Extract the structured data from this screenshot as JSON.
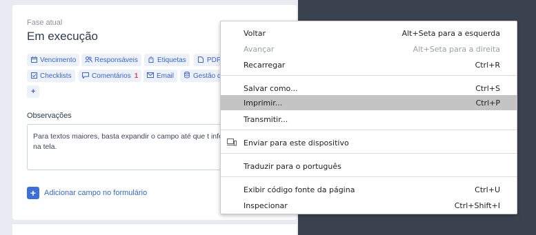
{
  "card": {
    "phase_label": "Fase atual",
    "phase_title": "Em execução",
    "chips": [
      {
        "label": "Vencimento",
        "icon": "calendar-icon"
      },
      {
        "label": "Responsáveis",
        "icon": "users-icon"
      },
      {
        "label": "Etiquetas",
        "icon": "tag-icon"
      },
      {
        "label": "PDF",
        "icon": "document-icon"
      },
      {
        "label": "Checklists",
        "icon": "checklist-icon"
      },
      {
        "label": "Comentários",
        "icon": "comment-icon",
        "count": "1"
      },
      {
        "label": "Email",
        "icon": "mail-icon"
      },
      {
        "label": "Gestão d",
        "icon": "database-icon"
      },
      {
        "label": "+",
        "icon": ""
      }
    ],
    "observations_label": "Observações",
    "observations_text": "Para textos maiores, basta expandir o campo até que t informação esteja visível na tela.",
    "add_field_label": "Adicionar campo no formulário"
  },
  "context_menu": {
    "items": [
      {
        "label": "Voltar",
        "shortcut": "Alt+Seta para a esquerda"
      },
      {
        "label": "Avançar",
        "shortcut": "Alt+Seta para a direita",
        "disabled": true
      },
      {
        "label": "Recarregar",
        "shortcut": "Ctrl+R"
      },
      {
        "label": "Salvar como...",
        "shortcut": "Ctrl+S"
      },
      {
        "label": "Imprimir...",
        "shortcut": "Ctrl+P",
        "highlighted": true
      },
      {
        "label": "Transmitir...",
        "shortcut": ""
      },
      {
        "label": "Enviar para este dispositivo",
        "shortcut": "",
        "icon": "devices-icon"
      },
      {
        "label": "Traduzir para o português",
        "shortcut": ""
      },
      {
        "label": "Exibir código fonte da página",
        "shortcut": "Ctrl+U"
      },
      {
        "label": "Inspecionar",
        "shortcut": "Ctrl+Shift+I"
      }
    ]
  },
  "colors": {
    "accent": "#3466d6",
    "badge": "#e0484a",
    "menu_hover": "#c4c4c4"
  }
}
